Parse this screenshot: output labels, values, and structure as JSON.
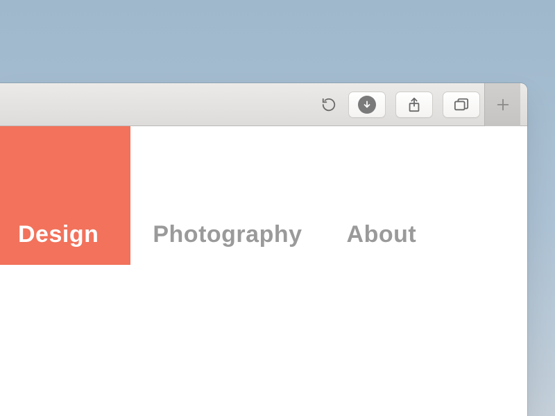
{
  "browser": {
    "toolbar": {
      "icons": {
        "reload": "reload",
        "downloads": "downloads",
        "share": "share",
        "tabs": "tabs",
        "new_tab": "new-tab"
      }
    }
  },
  "page": {
    "nav": {
      "items": [
        {
          "label": "Design",
          "active": true
        },
        {
          "label": "Photography",
          "active": false
        },
        {
          "label": "About",
          "active": false
        }
      ]
    },
    "accent_color": "#f2725b"
  }
}
